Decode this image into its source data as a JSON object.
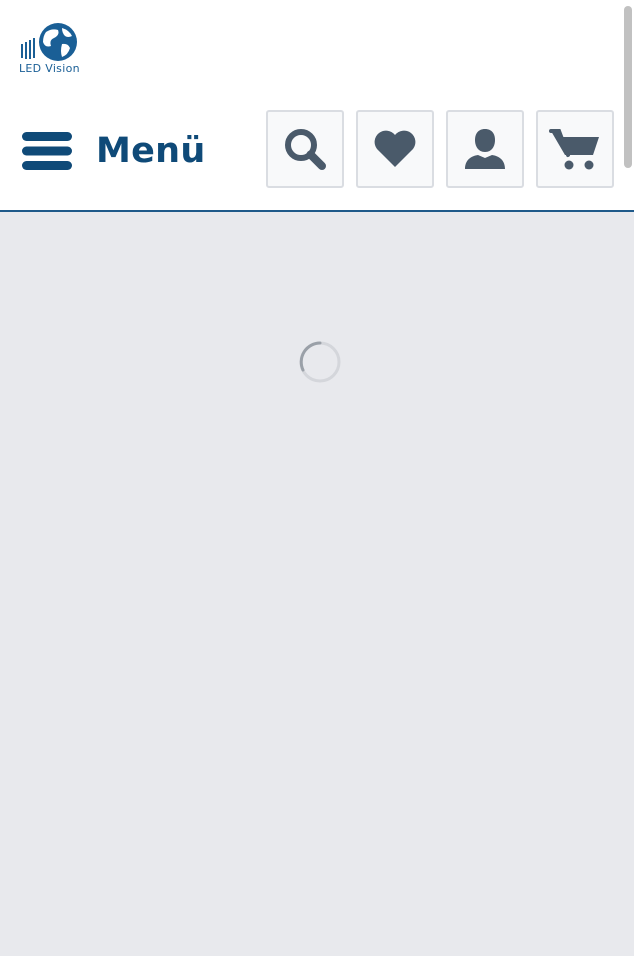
{
  "brand": {
    "name": "LED Vision"
  },
  "header": {
    "menu_label": "Menü",
    "actions": [
      {
        "icon": "search-icon"
      },
      {
        "icon": "heart-icon"
      },
      {
        "icon": "user-icon"
      },
      {
        "icon": "cart-icon"
      }
    ]
  },
  "colors": {
    "brand_blue": "#0f4a78",
    "icon_gray": "#4a5a6a",
    "background": "#e8e9ed"
  },
  "main": {
    "state": "loading"
  }
}
